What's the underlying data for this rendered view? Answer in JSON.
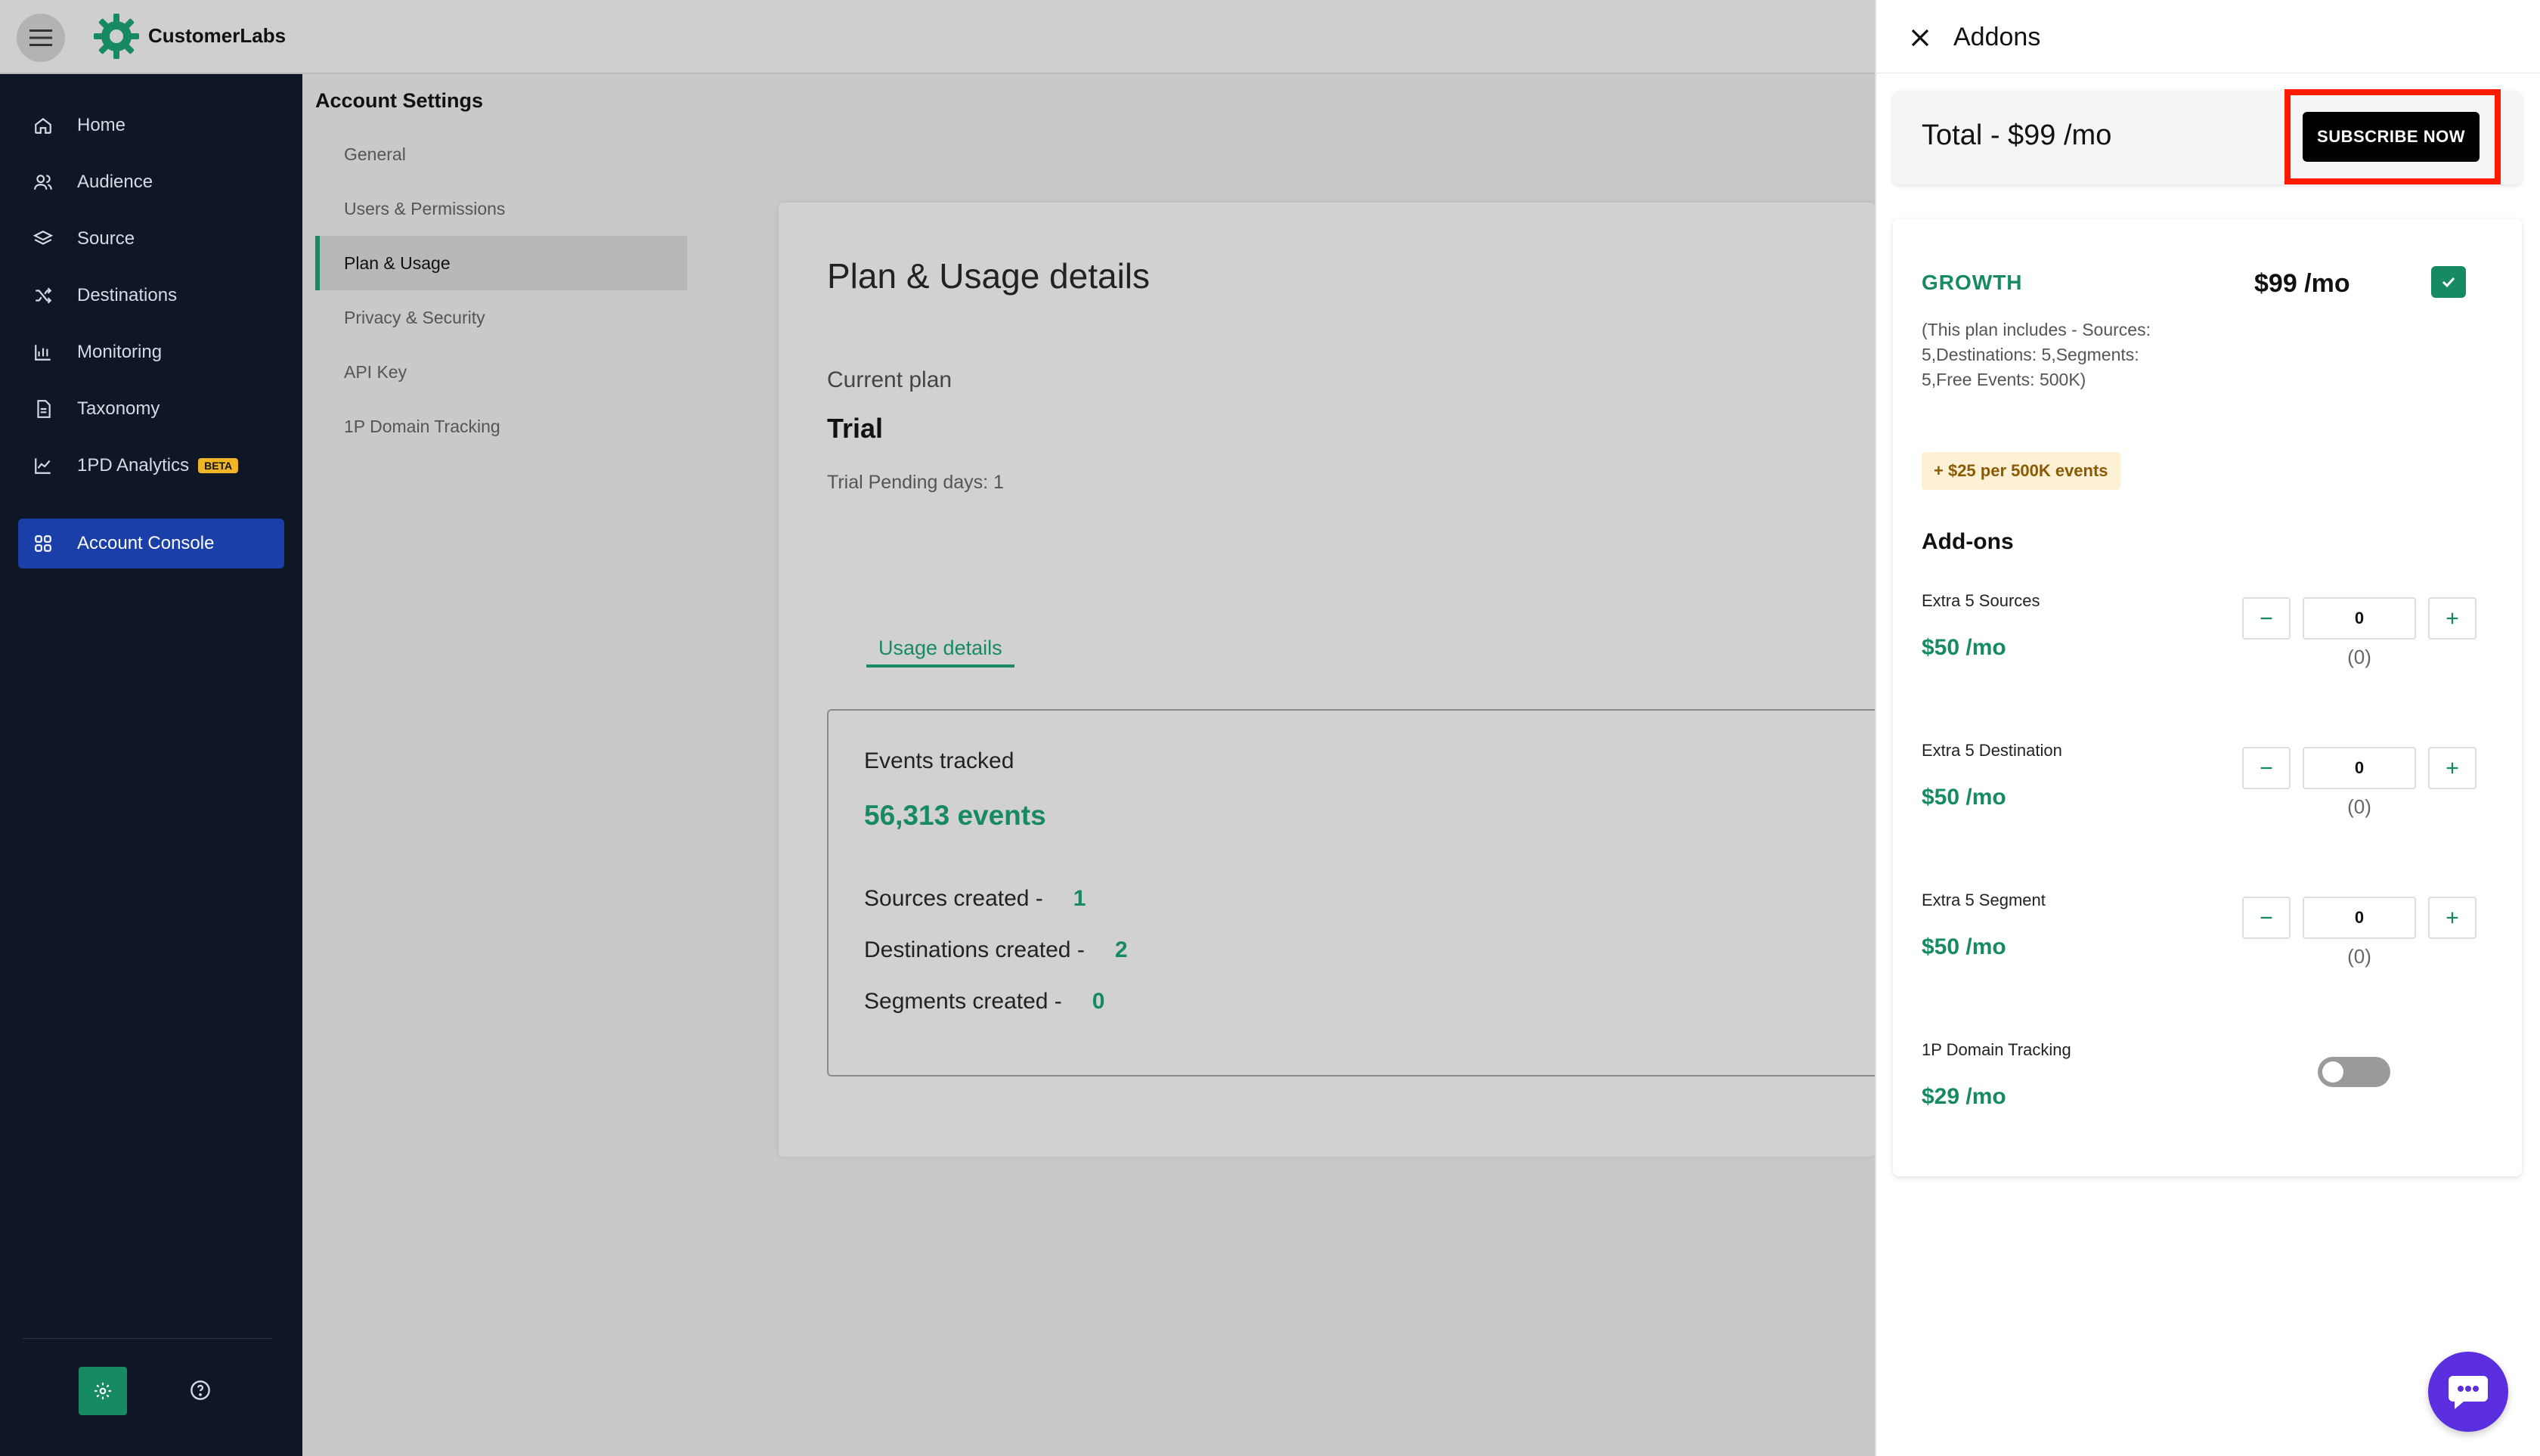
{
  "header": {
    "brand": "CustomerLabs"
  },
  "nav": {
    "items": [
      {
        "label": "Home",
        "icon": "home-icon"
      },
      {
        "label": "Audience",
        "icon": "users-icon"
      },
      {
        "label": "Source",
        "icon": "layers-icon"
      },
      {
        "label": "Destinations",
        "icon": "shuffle-icon"
      },
      {
        "label": "Monitoring",
        "icon": "bar-chart-icon"
      },
      {
        "label": "Taxonomy",
        "icon": "document-icon"
      },
      {
        "label": "1PD Analytics",
        "icon": "line-chart-icon",
        "badge": "BETA"
      },
      {
        "label": "Account Console",
        "icon": "grid-icon",
        "active": true
      }
    ]
  },
  "settings": {
    "title": "Account Settings",
    "items": [
      "General",
      "Users & Permissions",
      "Plan & Usage",
      "Privacy & Security",
      "API Key",
      "1P Domain Tracking"
    ],
    "active": "Plan & Usage"
  },
  "main": {
    "title": "Plan & Usage details",
    "current_plan_label": "Current plan",
    "current_plan": "Trial",
    "trial_days": "Trial Pending days: 1",
    "usage_tab": "Usage details",
    "events_label": "Events tracked",
    "events_value": "56,313 events",
    "stats": [
      {
        "label": "Sources created -",
        "value": "1"
      },
      {
        "label": "Destinations created -",
        "value": "2"
      },
      {
        "label": "Segments created -",
        "value": "0"
      }
    ]
  },
  "panel": {
    "title": "Addons",
    "total": "Total - $99 /mo",
    "subscribe_label": "SUBSCRIBE NOW",
    "plan_name": "GROWTH",
    "plan_price": "$99 /mo",
    "plan_desc": "(This plan includes - Sources: 5,Destinations: 5,Segments: 5,Free Events: 500K)",
    "extra_events": "+ $25 per 500K events",
    "addons_heading": "Add-ons",
    "addons": [
      {
        "name": "Extra 5 Sources",
        "price": "$50 /mo",
        "qty": "0",
        "sub": "(0)"
      },
      {
        "name": "Extra 5 Destination",
        "price": "$50 /mo",
        "qty": "0",
        "sub": "(0)"
      },
      {
        "name": "Extra 5 Segment",
        "price": "$50 /mo",
        "qty": "0",
        "sub": "(0)"
      }
    ],
    "domain_tracking": {
      "name": "1P Domain Tracking",
      "price": "$29 /mo",
      "enabled": false
    }
  },
  "colors": {
    "accent": "#178a64",
    "nav_bg": "#0f1726",
    "nav_active": "#1b3fa8",
    "highlight": "#ff1a00",
    "chat": "#5b2ee0"
  }
}
